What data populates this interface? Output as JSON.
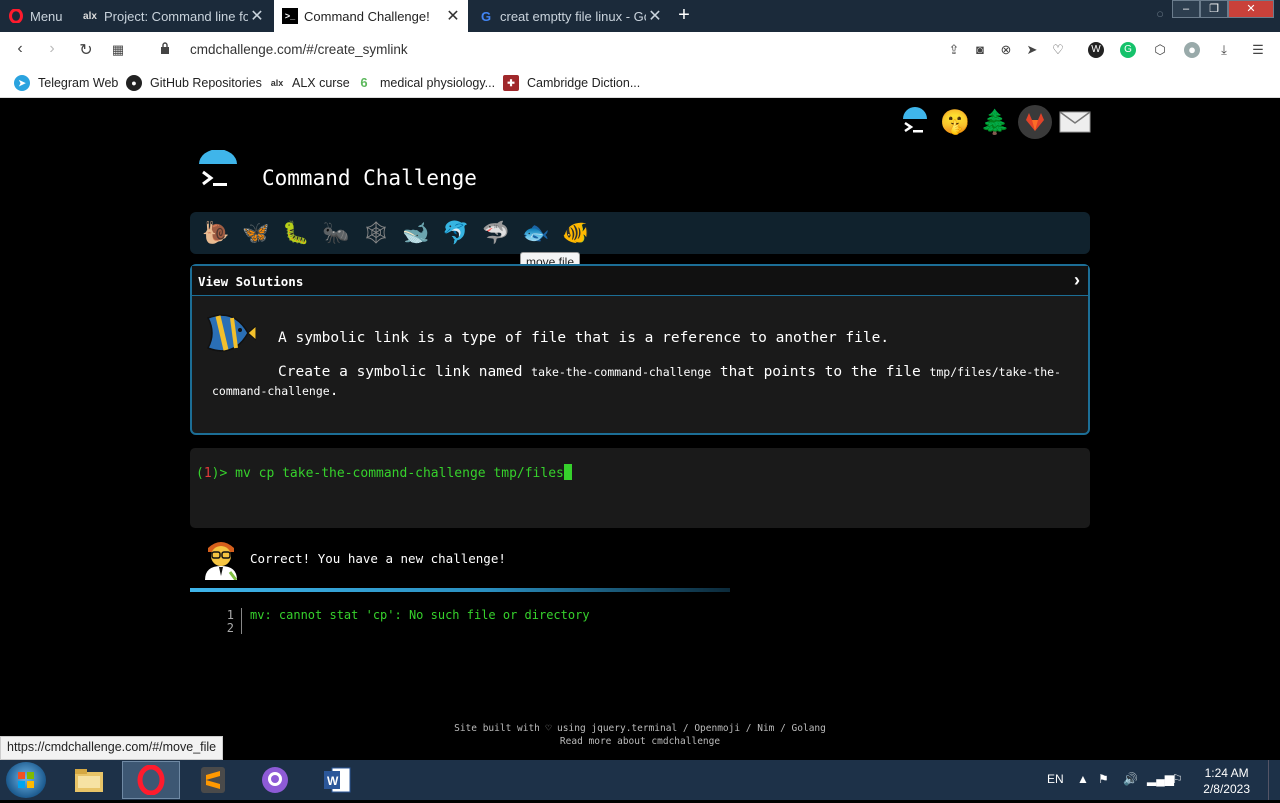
{
  "browser": {
    "menu_label": "Menu",
    "tabs": [
      {
        "label": "Project: Command line for t",
        "icon": "alx-icon"
      },
      {
        "label": "Command Challenge!",
        "icon": "terminal-icon"
      },
      {
        "label": "creat emptty file linux - Go",
        "icon": "google-icon"
      }
    ],
    "url": "cmdchallenge.com/#/create_symlink",
    "bookmarks": [
      {
        "label": "Telegram Web",
        "icon": "telegram-icon"
      },
      {
        "label": "GitHub Repositories",
        "icon": "github-icon"
      },
      {
        "label": "ALX curse",
        "icon": "alx-icon"
      },
      {
        "label": "medical physiology...",
        "icon": "leaf-icon"
      },
      {
        "label": "Cambridge Diction...",
        "icon": "cambridge-icon"
      }
    ],
    "status_url": "https://cmdchallenge.com/#/move_file"
  },
  "site": {
    "title": "Command Challenge",
    "top_icons": [
      "terminal-icon",
      "shushing-face-icon",
      "tree-icon",
      "gitlab-icon",
      "envelope-icon"
    ],
    "levels": [
      "snail-icon",
      "butterfly-icon",
      "caterpillar-icon",
      "ant-icon",
      "spider-web-icon",
      "whale-icon",
      "dolphin-icon",
      "shark-icon",
      "fish-icon",
      "tropical-fish-icon"
    ],
    "tooltip": "move file",
    "panel": {
      "header": "View Solutions",
      "description_line1": "A symbolic link is a type of file that is a reference to another file.",
      "desc2_pre": "Create a symbolic link named ",
      "desc2_code1": "take-the-command-challenge",
      "desc2_mid": " that points to the file ",
      "desc2_code2": "tmp/files/take-the-command-challenge",
      "desc2_post": "."
    },
    "terminal": {
      "prompt_open": "(",
      "prompt_num": "1",
      "prompt_close": ")> ",
      "command": "mv cp take-the-command-challenge tmp/files"
    },
    "result_message": "Correct! You have a new challenge!",
    "progress_fraction": 0.6,
    "output_lines": [
      {
        "n": "1",
        "text": "mv: cannot stat 'cp': No such file or directory"
      },
      {
        "n": "2",
        "text": ""
      }
    ],
    "footer_line1": "Site built with ♡ using jquery.terminal / Openmoji / Nim / Golang",
    "footer_line2": "Read more about cmdchallenge"
  },
  "taskbar": {
    "apps": [
      "explorer-icon",
      "opera-icon",
      "sublime-icon",
      "github-desktop-icon",
      "word-icon"
    ],
    "lang": "EN",
    "time": "1:24 AM",
    "date": "2/8/2023"
  }
}
